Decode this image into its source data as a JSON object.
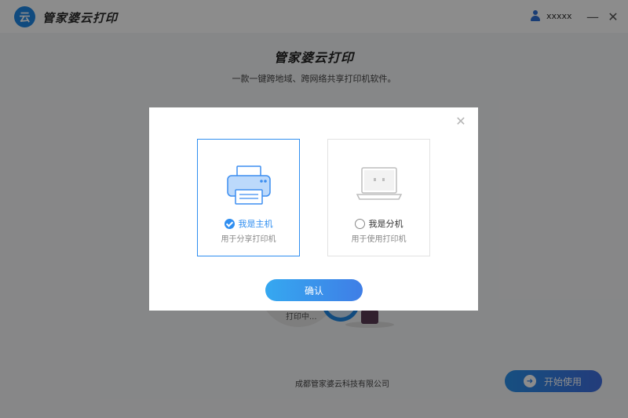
{
  "titlebar": {
    "logo_char": "云",
    "app_name": "管家婆云打印",
    "user_name": "xxxxx",
    "minimize_symbol": "—",
    "close_symbol": "✕"
  },
  "hero": {
    "title": "管家婆云打印",
    "subtitle": "一款一键跨地域、跨网络共享打印机软件。"
  },
  "illustration": {
    "status_text": "打印中..."
  },
  "footer": {
    "company": "成都管家婆云科技有限公司",
    "start_button": "开始使用"
  },
  "modal": {
    "close_symbol": "✕",
    "options": [
      {
        "label": "我是主机",
        "description": "用于分享打印机",
        "selected": true,
        "icon": "printer-icon"
      },
      {
        "label": "我是分机",
        "description": "用于使用打印机",
        "selected": false,
        "icon": "laptop-icon"
      }
    ],
    "confirm_button": "确认"
  },
  "colors": {
    "accent": "#2f8ef0",
    "brand": "#1e88e5"
  }
}
